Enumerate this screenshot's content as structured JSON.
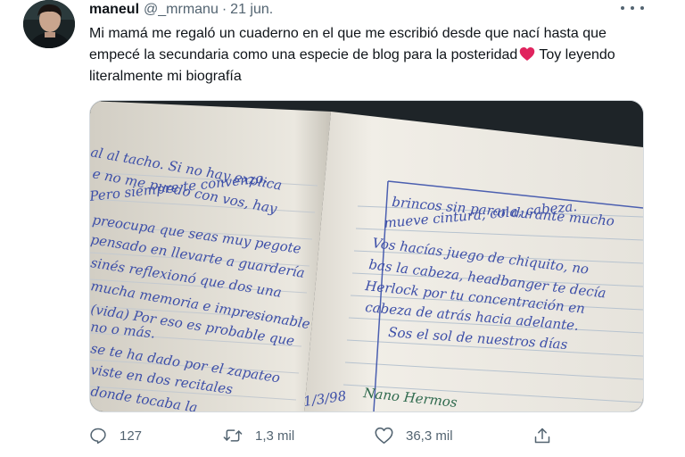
{
  "tweet": {
    "author_name": "maneul",
    "author_handle": "@_mrmanu",
    "separator": "·",
    "date": "21 jun.",
    "text_before_emoji": "Mi mamá me regaló un cuaderno en el que me escribió desde que nací hasta que empecé la secundaria como una especie de blog para la posteridad",
    "emoji": "red-heart-icon",
    "text_after_emoji": "Toy leyendo literalmente mi biografía"
  },
  "photo": {
    "left_page_lines": [
      "al al tacho. Si no hay explica",
      "e no me puedo con vos, hay",
      "Pero siempre te convenzo.",
      "preocupa que seas muy pegote",
      "pensado en llevarte a guardería",
      "sinés reflexionó que dos una",
      "mucha memoria e impresionable",
      "(vida) Por eso es probable que",
      "no o más.",
      "se te ha dado por el zapateo",
      "viste en dos recitales",
      "donde tocaba la"
    ],
    "right_page_lines": [
      "brincos sin parar durante mucho",
      "mueve cintura, cola, cabeza.",
      "Vos hacías juego de chiquito, no",
      "bas la cabeza, headbanger te decía",
      "Herlock por tu concentración en",
      "cabeza de atrás hacia adelante.",
      "Sos el sol de nuestros días"
    ],
    "date_note": "1/3/98",
    "signature": "Nano Hermos"
  },
  "actions": {
    "reply_count": "127",
    "retweet_count": "1,3 mil",
    "like_count": "36,3 mil"
  },
  "colors": {
    "text": "#0f1419",
    "secondary": "#536471",
    "heart": "#e0245e",
    "ink": "#3d4fa8"
  }
}
